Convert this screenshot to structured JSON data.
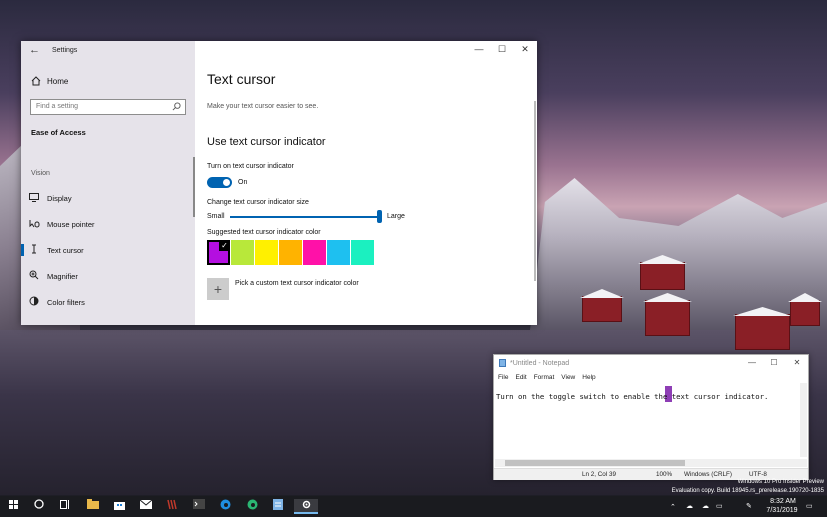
{
  "settings": {
    "window_title": "Settings",
    "back_glyph": "←",
    "minimize": "—",
    "maximize": "☐",
    "close": "✕",
    "home_label": "Home",
    "search_placeholder": "Find a setting",
    "section_title": "Ease of Access",
    "group_label": "Vision",
    "nav_items": [
      {
        "label": "Display",
        "icon": "display-icon"
      },
      {
        "label": "Mouse pointer",
        "icon": "mouse-pointer-icon"
      },
      {
        "label": "Text cursor",
        "icon": "text-cursor-icon"
      },
      {
        "label": "Magnifier",
        "icon": "magnifier-icon"
      },
      {
        "label": "Color filters",
        "icon": "color-filters-icon"
      }
    ],
    "page_title": "Text cursor",
    "page_desc": "Make your text cursor easier to see.",
    "indicator_heading": "Use text cursor indicator",
    "toggle_label": "Turn on text cursor indicator",
    "toggle_state": "On",
    "size_label": "Change text cursor indicator size",
    "size_min": "Small",
    "size_max": "Large",
    "size_value_fraction": 1.0,
    "color_label": "Suggested text cursor indicator color",
    "swatches": [
      "#b40fe0",
      "#b8e83a",
      "#fff000",
      "#ffb300",
      "#ff11a8",
      "#1ec0f0",
      "#1bf0c0"
    ],
    "selected_swatch": 0,
    "custom_color_label": "Pick a custom text cursor indicator color",
    "plus_glyph": "+"
  },
  "notepad": {
    "title": "*Untitled - Notepad",
    "minimize": "—",
    "maximize": "☐",
    "close": "✕",
    "menu": [
      "File",
      "Edit",
      "Format",
      "View",
      "Help"
    ],
    "text": "Turn on the toggle switch to enable the text cursor indicator.",
    "status": {
      "position": "Ln 2, Col 39",
      "zoom": "100%",
      "line_endings": "Windows (CRLF)",
      "encoding": "UTF-8"
    }
  },
  "watermark": {
    "line1": "Windows 10 Pro Insider Preview",
    "line2": "Evaluation copy. Build 18945.rs_prerelease.190720-1835"
  },
  "taskbar": {
    "clock_time": "8:32 AM",
    "clock_date": "7/31/2019"
  }
}
